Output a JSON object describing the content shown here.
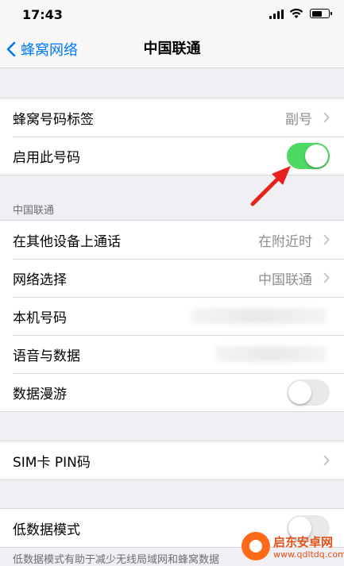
{
  "status_bar": {
    "time": "17:43"
  },
  "nav": {
    "back_label": "蜂窝网络",
    "title": "中国联通"
  },
  "group1": {
    "rows": [
      {
        "label": "蜂窝号码标签",
        "value": "副号"
      },
      {
        "label": "启用此号码",
        "toggle": "on"
      }
    ]
  },
  "section2": {
    "header": "中国联通",
    "rows": [
      {
        "label": "在其他设备上通话",
        "value": "在附近时"
      },
      {
        "label": "网络选择",
        "value": "中国联通"
      },
      {
        "label": "本机号码",
        "value": ""
      },
      {
        "label": "语音与数据",
        "value": ""
      },
      {
        "label": "数据漫游",
        "toggle": "off"
      }
    ]
  },
  "group3": {
    "rows": [
      {
        "label": "SIM卡 PIN码"
      }
    ]
  },
  "group4": {
    "rows": [
      {
        "label": "低数据模式"
      }
    ]
  },
  "footer_note": "低数据模式有助于减少无线局域网和蜂窝数据",
  "watermark": {
    "title": "启东安卓网",
    "url": "www.qdltdq.com"
  },
  "colors": {
    "accent": "#007aff",
    "toggle_on": "#4cd964",
    "arrow": "#e8231d"
  }
}
